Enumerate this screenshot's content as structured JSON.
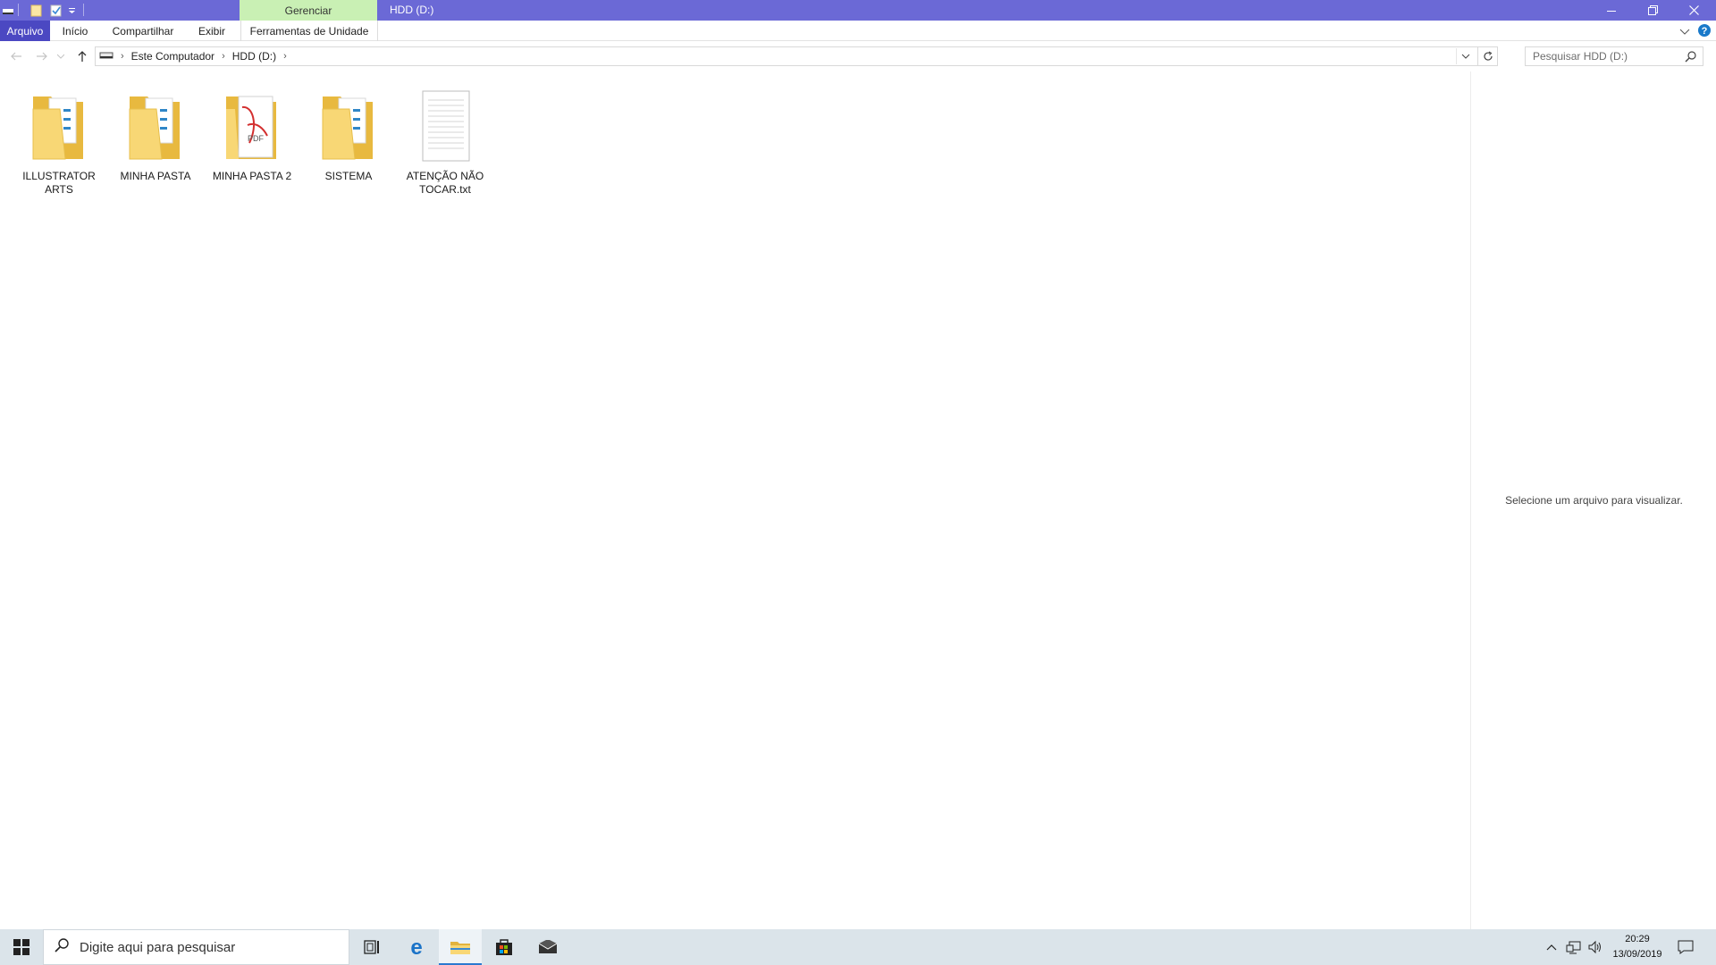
{
  "titlebar": {
    "context_tab": "Gerenciar",
    "title": "HDD (D:)"
  },
  "ribbon": {
    "tabs": [
      "Arquivo",
      "Início",
      "Compartilhar",
      "Exibir",
      "Ferramentas de Unidade"
    ]
  },
  "address": {
    "crumbs": [
      "Este Computador",
      "HDD (D:)"
    ],
    "search_placeholder": "Pesquisar HDD (D:)"
  },
  "items": [
    {
      "name": "ILLUSTRATOR ARTS",
      "type": "folder",
      "icon": "folder-icon"
    },
    {
      "name": "MINHA PASTA",
      "type": "folder",
      "icon": "folder-icon"
    },
    {
      "name": "MINHA PASTA 2",
      "type": "folder",
      "icon": "folder-pdf-icon"
    },
    {
      "name": "SISTEMA",
      "type": "folder",
      "icon": "folder-icon"
    },
    {
      "name": "ATENÇÃO NÃO TOCAR.txt",
      "type": "file",
      "icon": "text-file-icon"
    }
  ],
  "preview": {
    "message": "Selecione um arquivo para visualizar."
  },
  "taskbar": {
    "search_placeholder": "Digite aqui para pesquisar",
    "time": "20:29",
    "date": "13/09/2019"
  },
  "colors": {
    "titlebar": "#6b69d6",
    "manage_tab": "#c9f0b4",
    "file_tab": "#4b48c2",
    "taskbar": "#dbe4ea",
    "folder": "#f8d775"
  }
}
